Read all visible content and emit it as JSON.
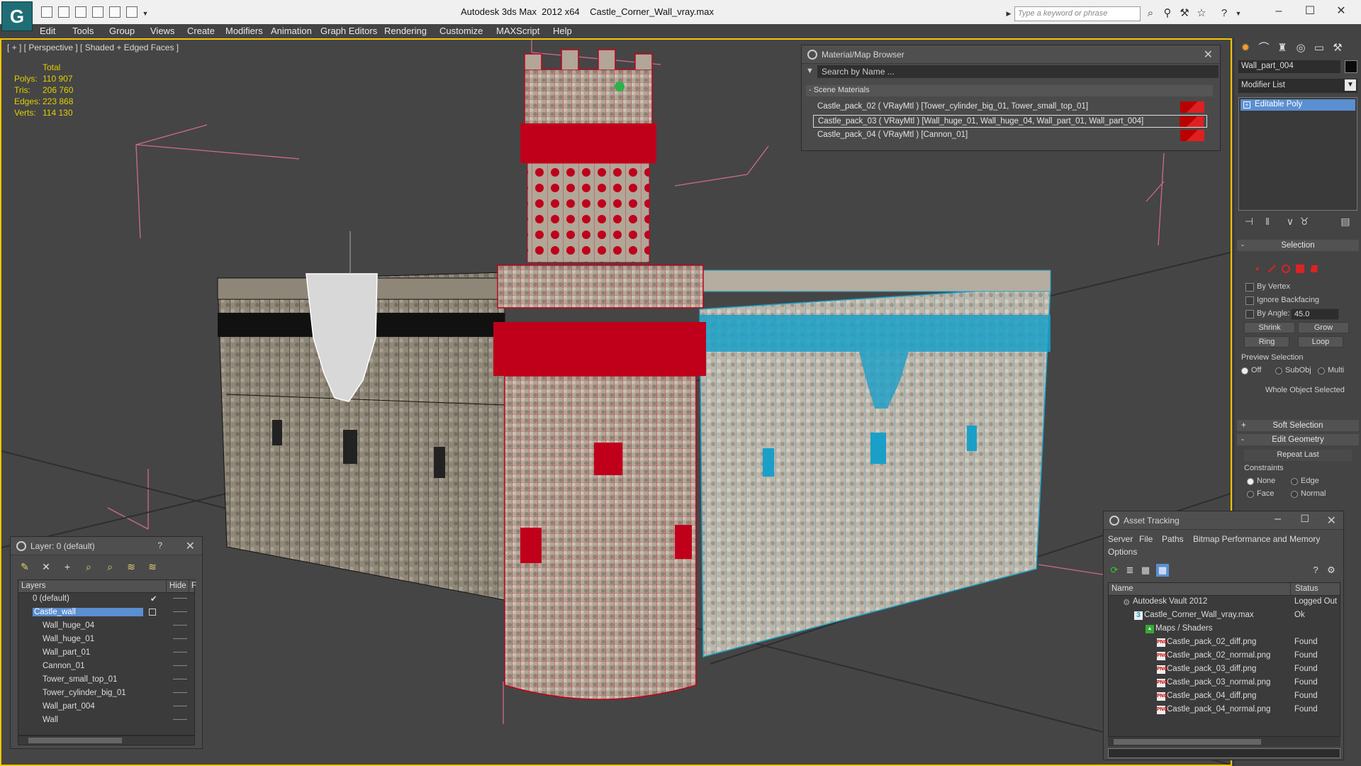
{
  "title": {
    "app": "Autodesk 3ds Max  2012 x64",
    "file": "Castle_Corner_Wall_vray.max",
    "search_placeholder": "Type a keyword or phrase"
  },
  "menu": [
    "Edit",
    "Tools",
    "Group",
    "Views",
    "Create",
    "Modifiers",
    "Animation",
    "Graph Editors",
    "Rendering",
    "Customize",
    "MAXScript",
    "Help"
  ],
  "viewport": {
    "label": "[ + ] [ Perspective ] [ Shaded + Edged Faces ]",
    "stats": {
      "total_label": "Total",
      "rows": [
        {
          "label": "Polys:",
          "value": "110 907"
        },
        {
          "label": "Tris:",
          "value": "206 760"
        },
        {
          "label": "Edges:",
          "value": "223 868"
        },
        {
          "label": "Verts:",
          "value": "114 130"
        }
      ]
    }
  },
  "material_browser": {
    "title": "Material/Map Browser",
    "search": "Search by Name ...",
    "section": "- Scene Materials",
    "materials": [
      "Castle_pack_02  ( VRayMtl )  [Tower_cylinder_big_01, Tower_small_top_01]",
      "Castle_pack_03  ( VRayMtl )  [Wall_huge_01, Wall_huge_04, Wall_part_01, Wall_part_004]",
      "Castle_pack_04  ( VRayMtl )  [Cannon_01]"
    ]
  },
  "command_panel": {
    "object_name": "Wall_part_004",
    "modifier_list": "Modifier List",
    "modifier": "Editable Poly",
    "selection": {
      "title": "Selection",
      "by_vertex": "By Vertex",
      "ignore_backfacing": "Ignore Backfacing",
      "by_angle": "By Angle:",
      "angle_value": "45.0",
      "shrink": "Shrink",
      "grow": "Grow",
      "ring": "Ring",
      "loop": "Loop",
      "preview": "Preview Selection",
      "off": "Off",
      "subobj": "SubObj",
      "multi": "Multi",
      "status": "Whole Object Selected"
    },
    "soft_selection": "Soft Selection",
    "edit_geometry": "Edit Geometry",
    "repeat_last": "Repeat Last",
    "constraints": {
      "title": "Constraints",
      "none": "None",
      "edge": "Edge",
      "face": "Face",
      "normal": "Normal"
    }
  },
  "layer_panel": {
    "title": "Layer: 0 (default)",
    "help": "?",
    "col_layers": "Layers",
    "col_hide": "Hide",
    "col_f": "F",
    "layers": [
      {
        "name": "0 (default)",
        "level": 0
      },
      {
        "name": "Castle_wall",
        "level": 0
      },
      {
        "name": "Wall_huge_04",
        "level": 1
      },
      {
        "name": "Wall_huge_01",
        "level": 1
      },
      {
        "name": "Wall_part_01",
        "level": 1
      },
      {
        "name": "Cannon_01",
        "level": 1
      },
      {
        "name": "Tower_small_top_01",
        "level": 1
      },
      {
        "name": "Tower_cylinder_big_01",
        "level": 1
      },
      {
        "name": "Wall_part_004",
        "level": 1
      },
      {
        "name": "Wall",
        "level": 1
      }
    ]
  },
  "asset_tracking": {
    "title": "Asset Tracking",
    "menu": [
      "Server",
      "File",
      "Paths",
      "Bitmap Performance and Memory",
      "Options"
    ],
    "col_name": "Name",
    "col_status": "Status",
    "rows": [
      {
        "name": "Autodesk Vault 2012",
        "status": "Logged Out ...",
        "level": 0
      },
      {
        "name": "Castle_Corner_Wall_vray.max",
        "status": "Ok",
        "level": 1
      },
      {
        "name": "Maps / Shaders",
        "status": "",
        "level": 2
      },
      {
        "name": "Castle_pack_02_diff.png",
        "status": "Found",
        "level": 3
      },
      {
        "name": "Castle_pack_02_normal.png",
        "status": "Found",
        "level": 3
      },
      {
        "name": "Castle_pack_03_diff.png",
        "status": "Found",
        "level": 3
      },
      {
        "name": "Castle_pack_03_normal.png",
        "status": "Found",
        "level": 3
      },
      {
        "name": "Castle_pack_04_diff.png",
        "status": "Found",
        "level": 3
      },
      {
        "name": "Castle_pack_04_normal.png",
        "status": "Found",
        "level": 3
      }
    ]
  },
  "colors": {
    "viewport_border": "#f3c500",
    "selected_red": "#c0001a",
    "selected_cyan": "#1aa0c8",
    "selection_blue": "#5b8fd1",
    "stats_yellow": "#e0d000"
  }
}
